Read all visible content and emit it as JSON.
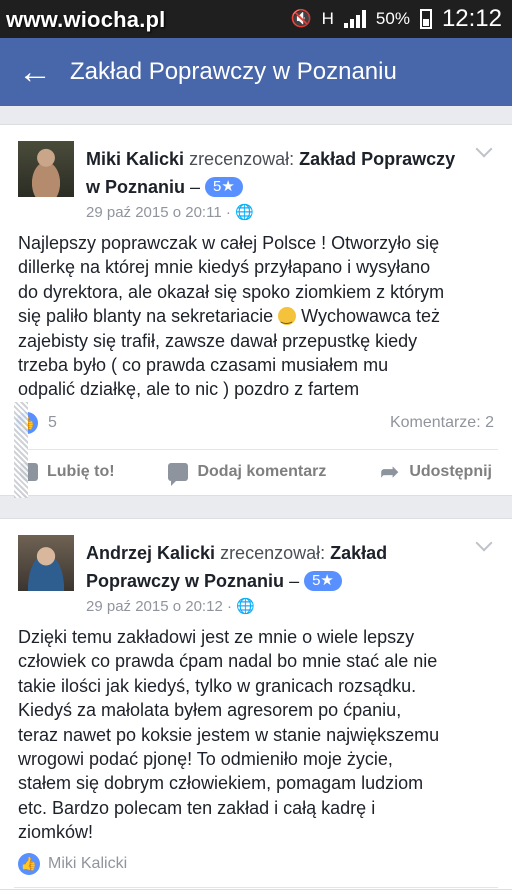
{
  "watermark": "www.wiocha.pl",
  "status": {
    "network": "H",
    "battery": "50%",
    "time": "12:12"
  },
  "app_bar": {
    "title": "Zakład Poprawczy w Poznaniu"
  },
  "reviews": [
    {
      "author": "Miki Kalicki",
      "action": "zrecenzował:",
      "page": "Zakład Poprawczy w Poznaniu",
      "dash": "–",
      "rating": "5★",
      "date": "29 paź 2015 o 20:11",
      "dot": "·",
      "text_lines": [
        "Najlepszy poprawczak w całej Polsce ! Otworzyło się",
        "dillerkę na której mnie kiedyś przyłapano i wysyłano",
        "do dyrektora, ale okazał się spoko ziomkiem z którym",
        "się paliło blanty na sekretariacie",
        "Wychowawca też",
        "zajebisty się trafił, zawsze dawał przepustkę kiedy",
        "trzeba było ( co prawda czasami musiałem mu",
        "odpalić działkę, ale to nic ) pozdro z fartem"
      ],
      "likes": "5",
      "comments": "Komentarze: 2",
      "actions": {
        "like": "Lubię to!",
        "comment": "Dodaj komentarz",
        "share": "Udostępnij"
      }
    },
    {
      "author": "Andrzej Kalicki",
      "action": "zrecenzował:",
      "page": "Zakład Poprawczy w Poznaniu",
      "dash": "–",
      "rating": "5★",
      "date": "29 paź 2015 o 20:12",
      "dot": "·",
      "text_lines": [
        "Dzięki temu zakładowi jest ze mnie o wiele lepszy",
        "człowiek co prawda ćpam nadal bo mnie stać ale nie",
        "takie ilości jak kiedyś, tylko w granicach rozsądku.",
        "Kiedyś za małolata byłem agresorem po ćpaniu,",
        "teraz nawet po koksie jestem w stanie największemu",
        "wrogowi podać pjonę! To odmieniło moje życie,",
        "stałem się dobrym człowiekiem, pomagam ludziom",
        "etc. Bardzo polecam ten zakład i całą kadrę i",
        "ziomków!"
      ],
      "liked_by": "Miki Kalicki"
    }
  ]
}
